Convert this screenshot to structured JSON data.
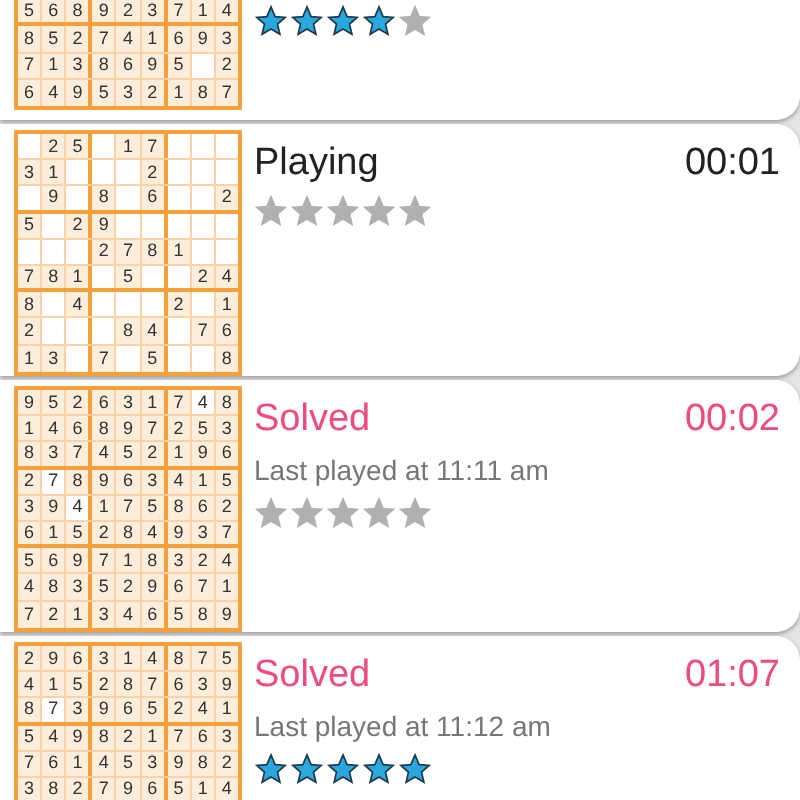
{
  "games": [
    {
      "kind": "cut",
      "stars": 4,
      "grid": [
        [
          {
            "digit": "5",
            "given": true
          },
          {
            "digit": "6",
            "given": true
          },
          {
            "digit": "8",
            "given": true
          },
          {
            "digit": "9",
            "given": true
          },
          {
            "digit": "2",
            "given": true
          },
          {
            "digit": "3",
            "given": true
          },
          {
            "digit": "7",
            "given": true
          },
          {
            "digit": "1",
            "given": true
          },
          {
            "digit": "4",
            "given": true
          }
        ],
        [
          {
            "digit": "8",
            "given": true
          },
          {
            "digit": "5",
            "given": true
          },
          {
            "digit": "2",
            "given": true
          },
          {
            "digit": "7",
            "given": true
          },
          {
            "digit": "4",
            "given": true
          },
          {
            "digit": "1",
            "given": true
          },
          {
            "digit": "6",
            "given": true
          },
          {
            "digit": "9",
            "given": true
          },
          {
            "digit": "3",
            "given": true
          }
        ],
        [
          {
            "digit": "7",
            "given": true
          },
          {
            "digit": "1",
            "given": true
          },
          {
            "digit": "3",
            "given": true
          },
          {
            "digit": "8",
            "given": true
          },
          {
            "digit": "6",
            "given": true
          },
          {
            "digit": "9",
            "given": true
          },
          {
            "digit": "5",
            "given": true
          },
          {
            "given": false
          },
          {
            "digit": "2",
            "given": true
          }
        ],
        [
          {
            "digit": "6",
            "given": true
          },
          {
            "digit": "4",
            "given": true
          },
          {
            "digit": "9",
            "given": true
          },
          {
            "digit": "5",
            "given": true
          },
          {
            "digit": "3",
            "given": true
          },
          {
            "digit": "2",
            "given": true
          },
          {
            "digit": "1",
            "given": true
          },
          {
            "digit": "8",
            "given": true
          },
          {
            "digit": "7",
            "given": true
          }
        ]
      ]
    },
    {
      "kind": "playing",
      "status": "Playing",
      "time": "00:01",
      "stars": 0,
      "grid": [
        [
          {
            "given": false
          },
          {
            "digit": "2",
            "given": true
          },
          {
            "digit": "5",
            "given": true
          },
          {
            "given": false
          },
          {
            "digit": "1",
            "given": true
          },
          {
            "digit": "7",
            "given": true
          },
          {
            "given": false
          },
          {
            "given": false
          },
          {
            "given": false
          }
        ],
        [
          {
            "digit": "3",
            "given": true
          },
          {
            "digit": "1",
            "given": true
          },
          {
            "given": false
          },
          {
            "given": false
          },
          {
            "given": false
          },
          {
            "digit": "2",
            "given": true
          },
          {
            "given": false
          },
          {
            "given": false
          },
          {
            "given": false
          }
        ],
        [
          {
            "given": false
          },
          {
            "digit": "9",
            "given": true
          },
          {
            "given": false
          },
          {
            "digit": "8",
            "given": true
          },
          {
            "given": false
          },
          {
            "digit": "6",
            "given": true
          },
          {
            "given": false
          },
          {
            "given": false
          },
          {
            "digit": "2",
            "given": true
          }
        ],
        [
          {
            "digit": "5",
            "given": true
          },
          {
            "given": false
          },
          {
            "digit": "2",
            "given": true
          },
          {
            "digit": "9",
            "given": true
          },
          {
            "given": false
          },
          {
            "given": false
          },
          {
            "given": false
          },
          {
            "given": false
          },
          {
            "given": false
          }
        ],
        [
          {
            "given": false
          },
          {
            "given": false
          },
          {
            "given": false
          },
          {
            "digit": "2",
            "given": true
          },
          {
            "digit": "7",
            "given": true
          },
          {
            "digit": "8",
            "given": true
          },
          {
            "digit": "1",
            "given": true
          },
          {
            "given": false
          },
          {
            "given": false
          }
        ],
        [
          {
            "digit": "7",
            "given": true
          },
          {
            "digit": "8",
            "given": true
          },
          {
            "digit": "1",
            "given": true
          },
          {
            "given": false
          },
          {
            "digit": "5",
            "given": true
          },
          {
            "given": false
          },
          {
            "given": false
          },
          {
            "digit": "2",
            "given": true
          },
          {
            "digit": "4",
            "given": true
          }
        ],
        [
          {
            "digit": "8",
            "given": true
          },
          {
            "given": false
          },
          {
            "digit": "4",
            "given": true
          },
          {
            "given": false
          },
          {
            "given": false
          },
          {
            "given": false
          },
          {
            "digit": "2",
            "given": true
          },
          {
            "given": false
          },
          {
            "digit": "1",
            "given": true
          }
        ],
        [
          {
            "digit": "2",
            "given": true
          },
          {
            "given": false
          },
          {
            "given": false
          },
          {
            "given": false
          },
          {
            "digit": "8",
            "given": true
          },
          {
            "digit": "4",
            "given": true
          },
          {
            "given": false
          },
          {
            "digit": "7",
            "given": true
          },
          {
            "digit": "6",
            "given": true
          }
        ],
        [
          {
            "digit": "1",
            "given": true
          },
          {
            "digit": "3",
            "given": true
          },
          {
            "given": false
          },
          {
            "digit": "7",
            "given": true
          },
          {
            "given": false
          },
          {
            "digit": "5",
            "given": true
          },
          {
            "given": false
          },
          {
            "given": false
          },
          {
            "digit": "8",
            "given": true
          }
        ]
      ]
    },
    {
      "kind": "solved",
      "status": "Solved",
      "time": "00:02",
      "last_played": "Last played at 11:11 am",
      "stars": 0,
      "grid": [
        [
          {
            "digit": "9",
            "given": true
          },
          {
            "digit": "5",
            "given": true
          },
          {
            "digit": "2",
            "given": true
          },
          {
            "digit": "6",
            "given": true
          },
          {
            "digit": "3",
            "given": true
          },
          {
            "digit": "1",
            "given": true
          },
          {
            "digit": "7",
            "given": true
          },
          {
            "digit": "4",
            "given": false
          },
          {
            "digit": "8",
            "given": true
          }
        ],
        [
          {
            "digit": "1",
            "given": true
          },
          {
            "digit": "4",
            "given": true
          },
          {
            "digit": "6",
            "given": true
          },
          {
            "digit": "8",
            "given": true
          },
          {
            "digit": "9",
            "given": true
          },
          {
            "digit": "7",
            "given": true
          },
          {
            "digit": "2",
            "given": true
          },
          {
            "digit": "5",
            "given": true
          },
          {
            "digit": "3",
            "given": true
          }
        ],
        [
          {
            "digit": "8",
            "given": true
          },
          {
            "digit": "3",
            "given": true
          },
          {
            "digit": "7",
            "given": true
          },
          {
            "digit": "4",
            "given": true
          },
          {
            "digit": "5",
            "given": true
          },
          {
            "digit": "2",
            "given": true
          },
          {
            "digit": "1",
            "given": true
          },
          {
            "digit": "9",
            "given": true
          },
          {
            "digit": "6",
            "given": true
          }
        ],
        [
          {
            "digit": "2",
            "given": true
          },
          {
            "digit": "7",
            "given": false
          },
          {
            "digit": "8",
            "given": true
          },
          {
            "digit": "9",
            "given": true
          },
          {
            "digit": "6",
            "given": true
          },
          {
            "digit": "3",
            "given": true
          },
          {
            "digit": "4",
            "given": true
          },
          {
            "digit": "1",
            "given": true
          },
          {
            "digit": "5",
            "given": true
          }
        ],
        [
          {
            "digit": "3",
            "given": true
          },
          {
            "digit": "9",
            "given": true
          },
          {
            "digit": "4",
            "given": false
          },
          {
            "digit": "1",
            "given": true
          },
          {
            "digit": "7",
            "given": true
          },
          {
            "digit": "5",
            "given": true
          },
          {
            "digit": "8",
            "given": true
          },
          {
            "digit": "6",
            "given": true
          },
          {
            "digit": "2",
            "given": true
          }
        ],
        [
          {
            "digit": "6",
            "given": true
          },
          {
            "digit": "1",
            "given": true
          },
          {
            "digit": "5",
            "given": true
          },
          {
            "digit": "2",
            "given": true
          },
          {
            "digit": "8",
            "given": true
          },
          {
            "digit": "4",
            "given": true
          },
          {
            "digit": "9",
            "given": true
          },
          {
            "digit": "3",
            "given": true
          },
          {
            "digit": "7",
            "given": true
          }
        ],
        [
          {
            "digit": "5",
            "given": true
          },
          {
            "digit": "6",
            "given": true
          },
          {
            "digit": "9",
            "given": true
          },
          {
            "digit": "7",
            "given": true
          },
          {
            "digit": "1",
            "given": true
          },
          {
            "digit": "8",
            "given": true
          },
          {
            "digit": "3",
            "given": true
          },
          {
            "digit": "2",
            "given": true
          },
          {
            "digit": "4",
            "given": true
          }
        ],
        [
          {
            "digit": "4",
            "given": true
          },
          {
            "digit": "8",
            "given": true
          },
          {
            "digit": "3",
            "given": true
          },
          {
            "digit": "5",
            "given": true
          },
          {
            "digit": "2",
            "given": true
          },
          {
            "digit": "9",
            "given": true
          },
          {
            "digit": "6",
            "given": true
          },
          {
            "digit": "7",
            "given": true
          },
          {
            "digit": "1",
            "given": true
          }
        ],
        [
          {
            "digit": "7",
            "given": true
          },
          {
            "digit": "2",
            "given": true
          },
          {
            "digit": "1",
            "given": true
          },
          {
            "digit": "3",
            "given": true
          },
          {
            "digit": "4",
            "given": true
          },
          {
            "digit": "6",
            "given": true
          },
          {
            "digit": "5",
            "given": true
          },
          {
            "digit": "8",
            "given": true
          },
          {
            "digit": "9",
            "given": true
          }
        ]
      ]
    },
    {
      "kind": "solved",
      "status": "Solved",
      "time": "01:07",
      "last_played": "Last played at 11:12 am",
      "stars": 5,
      "grid": [
        [
          {
            "digit": "2",
            "given": true
          },
          {
            "digit": "9",
            "given": true
          },
          {
            "digit": "6",
            "given": true
          },
          {
            "digit": "3",
            "given": true
          },
          {
            "digit": "1",
            "given": true
          },
          {
            "digit": "4",
            "given": true
          },
          {
            "digit": "8",
            "given": true
          },
          {
            "digit": "7",
            "given": true
          },
          {
            "digit": "5",
            "given": true
          }
        ],
        [
          {
            "digit": "4",
            "given": true
          },
          {
            "digit": "1",
            "given": true
          },
          {
            "digit": "5",
            "given": true
          },
          {
            "digit": "2",
            "given": true
          },
          {
            "digit": "8",
            "given": true
          },
          {
            "digit": "7",
            "given": true
          },
          {
            "digit": "6",
            "given": true
          },
          {
            "digit": "3",
            "given": true
          },
          {
            "digit": "9",
            "given": true
          }
        ],
        [
          {
            "digit": "8",
            "given": true
          },
          {
            "digit": "7",
            "given": false
          },
          {
            "digit": "3",
            "given": true
          },
          {
            "digit": "9",
            "given": true
          },
          {
            "digit": "6",
            "given": true
          },
          {
            "digit": "5",
            "given": true
          },
          {
            "digit": "2",
            "given": true
          },
          {
            "digit": "4",
            "given": true
          },
          {
            "digit": "1",
            "given": true
          }
        ],
        [
          {
            "digit": "5",
            "given": true
          },
          {
            "digit": "4",
            "given": true
          },
          {
            "digit": "9",
            "given": true
          },
          {
            "digit": "8",
            "given": true
          },
          {
            "digit": "2",
            "given": true
          },
          {
            "digit": "1",
            "given": true
          },
          {
            "digit": "7",
            "given": true
          },
          {
            "digit": "6",
            "given": true
          },
          {
            "digit": "3",
            "given": true
          }
        ],
        [
          {
            "digit": "7",
            "given": true
          },
          {
            "digit": "6",
            "given": true
          },
          {
            "digit": "1",
            "given": true
          },
          {
            "digit": "4",
            "given": true
          },
          {
            "digit": "5",
            "given": true
          },
          {
            "digit": "3",
            "given": true
          },
          {
            "digit": "9",
            "given": true
          },
          {
            "digit": "8",
            "given": true
          },
          {
            "digit": "2",
            "given": true
          }
        ],
        [
          {
            "digit": "3",
            "given": true
          },
          {
            "digit": "8",
            "given": true
          },
          {
            "digit": "2",
            "given": true
          },
          {
            "digit": "7",
            "given": true
          },
          {
            "digit": "9",
            "given": true
          },
          {
            "digit": "6",
            "given": true
          },
          {
            "digit": "5",
            "given": true
          },
          {
            "digit": "1",
            "given": true
          },
          {
            "digit": "4",
            "given": true
          }
        ]
      ]
    }
  ]
}
